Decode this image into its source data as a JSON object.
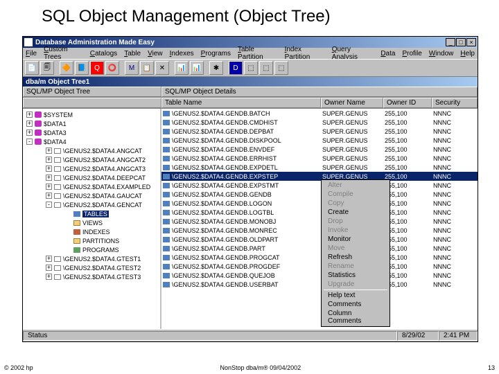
{
  "slide_title": "SQL Object Management (Object Tree)",
  "app_title": "Database Administration Made Easy",
  "menu": [
    "File",
    "Custom Trees",
    "Catalogs",
    "Table",
    "View",
    "Indexes",
    "Programs",
    "Table Partition",
    "Index Partition",
    "Query Analysis",
    "Data",
    "Profile",
    "Window",
    "Help"
  ],
  "child_title": "dba/m Object Tree1",
  "tree_header": "SQL/MP Object Tree",
  "details_headers": [
    "SQL/MP Object Details",
    "",
    "",
    ""
  ],
  "table_headers": [
    "Table Name",
    "Owner Name",
    "Owner ID",
    "Security"
  ],
  "tree_roots": [
    {
      "exp": "+",
      "icon": "disk",
      "label": "$SYSTEM"
    },
    {
      "exp": "+",
      "icon": "disk",
      "label": "$DATA1"
    },
    {
      "exp": "+",
      "icon": "disk",
      "label": "$DATA3"
    },
    {
      "exp": "-",
      "icon": "disk",
      "label": "$DATA4"
    }
  ],
  "tree_cats": [
    {
      "exp": "+",
      "label": "\\GENUS2.$DATA4.ANGCAT"
    },
    {
      "exp": "+",
      "label": "\\GENUS2.$DATA4.ANGCAT2"
    },
    {
      "exp": "+",
      "label": "\\GENUS2.$DATA4.ANGCAT3"
    },
    {
      "exp": "+",
      "label": "\\GENUS2.$DATA4.DEEPCAT"
    },
    {
      "exp": "+",
      "label": "\\GENUS2.$DATA4.EXAMPLED"
    },
    {
      "exp": "+",
      "label": "\\GENUS2.$DATA4.GAUCAT"
    },
    {
      "exp": "-",
      "label": "\\GENUS2.$DATA4.GENCAT"
    }
  ],
  "tree_subitems": [
    {
      "icon": "tbl",
      "label": "TABLES",
      "sel": true
    },
    {
      "icon": "fold",
      "label": "VIEWS"
    },
    {
      "icon": "ix",
      "label": "INDEXES"
    },
    {
      "icon": "fold",
      "label": "PARTITIONS"
    },
    {
      "icon": "pg",
      "label": "PROGRAMS"
    }
  ],
  "tree_tail": [
    {
      "exp": "+",
      "label": "\\GENUS2.$DATA4.GTEST1"
    },
    {
      "exp": "+",
      "label": "\\GENUS2.$DATA4.GTEST2"
    },
    {
      "exp": "+",
      "label": "\\GENUS2.$DATA4.GTEST3"
    }
  ],
  "rows": [
    {
      "name": "\\GENUS2.$DATA4.GENDB.BATCH",
      "owner": "SUPER.GENUS",
      "id": "255,100",
      "sec": "NNNC"
    },
    {
      "name": "\\GENUS2.$DATA4.GENDB.CMDHIST",
      "owner": "SUPER.GENUS",
      "id": "255,100",
      "sec": "NNNC"
    },
    {
      "name": "\\GENUS2.$DATA4.GENDB.DEPBAT",
      "owner": "SUPER.GENUS",
      "id": "255,100",
      "sec": "NNNC"
    },
    {
      "name": "\\GENUS2.$DATA4.GENDB.DISKPOOL",
      "owner": "SUPER.GENUS",
      "id": "255,100",
      "sec": "NNNC"
    },
    {
      "name": "\\GENUS2.$DATA4.GENDB.ENVDEF",
      "owner": "SUPER.GENUS",
      "id": "255,100",
      "sec": "NNNC"
    },
    {
      "name": "\\GENUS2.$DATA4.GENDB.ERRHIST",
      "owner": "SUPER.GENUS",
      "id": "255,100",
      "sec": "NNNC"
    },
    {
      "name": "\\GENUS2.$DATA4.GENDB.EXPDETL",
      "owner": "SUPER.GENUS",
      "id": "255,100",
      "sec": "NNNC"
    },
    {
      "name": "\\GENUS2.$DATA4.GENDB.EXPSTEP",
      "owner": "SUPER.GENUS",
      "id": "255,100",
      "sec": "NNNC",
      "sel": true
    },
    {
      "name": "\\GENUS2.$DATA4.GENDB.EXPSTMT",
      "owner": "",
      "id": "255,100",
      "sec": "NNNC"
    },
    {
      "name": "\\GENUS2.$DATA4.GENDB.GENDB",
      "owner": "",
      "id": "255,100",
      "sec": "NNNC"
    },
    {
      "name": "\\GENUS2.$DATA4.GENDB.LOGON",
      "owner": "",
      "id": "255,100",
      "sec": "NNNC"
    },
    {
      "name": "\\GENUS2.$DATA4.GENDB.LOGTBL",
      "owner": "",
      "id": "255,100",
      "sec": "NNNC"
    },
    {
      "name": "\\GENUS2.$DATA4.GENDB.MONOBJ",
      "owner": "",
      "id": "255,100",
      "sec": "NNNC"
    },
    {
      "name": "\\GENUS2.$DATA4.GENDB.MONREC",
      "owner": "",
      "id": "255,100",
      "sec": "NNNC"
    },
    {
      "name": "\\GENUS2.$DATA4.GENDB.OLDPART",
      "owner": "",
      "id": "255,100",
      "sec": "NNNC"
    },
    {
      "name": "\\GENUS2.$DATA4.GENDB.PART",
      "owner": "",
      "id": "255,100",
      "sec": "NNNC"
    },
    {
      "name": "\\GENUS2.$DATA4.GENDB.PROGCAT",
      "owner": "",
      "id": "255,100",
      "sec": "NNNC"
    },
    {
      "name": "\\GENUS2.$DATA4.GENDB.PROGDEF",
      "owner": "",
      "id": "255,100",
      "sec": "NNNC"
    },
    {
      "name": "\\GENUS2.$DATA4.GENDB.QUEJOB",
      "owner": "",
      "id": "255,100",
      "sec": "NNNC"
    },
    {
      "name": "\\GENUS2.$DATA4.GENDB.USERBAT",
      "owner": "",
      "id": "255,100",
      "sec": "NNNC"
    }
  ],
  "context_menu": [
    {
      "t": "Alter",
      "dis": true
    },
    {
      "t": "Compile",
      "dis": true
    },
    {
      "t": "Copy",
      "dis": true
    },
    {
      "t": "Create",
      "dis": false
    },
    {
      "t": "Drop",
      "dis": true
    },
    {
      "t": "Invoke",
      "dis": true
    },
    {
      "t": "Monitor",
      "dis": false
    },
    {
      "t": "Move",
      "dis": true
    },
    {
      "t": "Refresh",
      "dis": false
    },
    {
      "t": "Rename",
      "dis": true
    },
    {
      "t": "Statistics",
      "dis": false
    },
    {
      "t": "Upgrade",
      "dis": true
    },
    {
      "sep": true
    },
    {
      "t": "Help text",
      "dis": false
    },
    {
      "t": "Comments",
      "dis": false
    },
    {
      "t": "Column Comments",
      "dis": false
    }
  ],
  "status_left": "Status",
  "status_date": "8/29/02",
  "status_time": "2:41 PM",
  "footer_left": "© 2002 hp",
  "footer_center": "NonStop dba/m® 09/04/2002",
  "footer_right": "13",
  "col_widths": {
    "name": 230,
    "owner": 90,
    "id": 70,
    "sec": 60
  }
}
